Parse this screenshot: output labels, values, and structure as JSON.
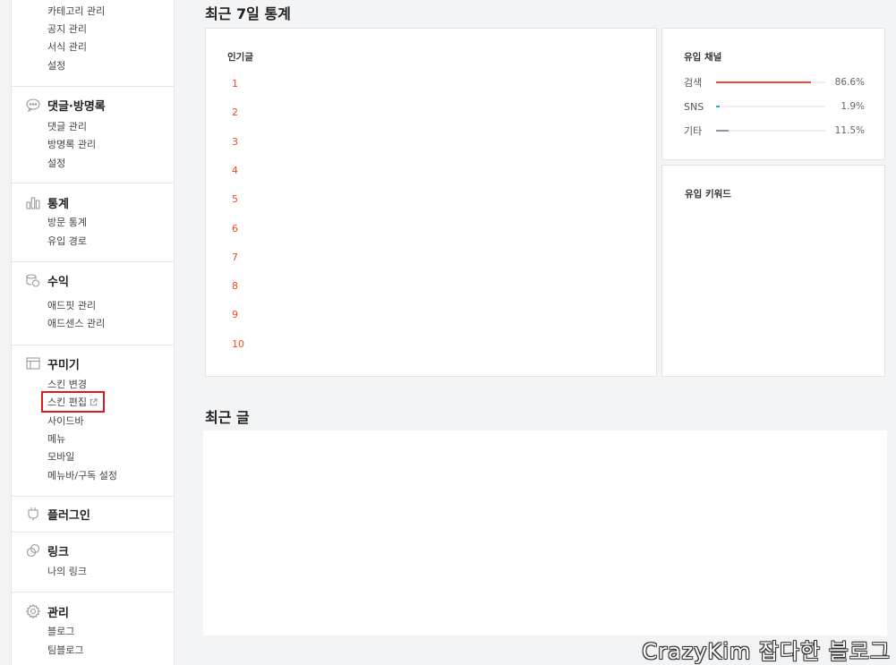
{
  "sidebar": {
    "top_items": [
      "카테고리 관리",
      "공지 관리",
      "서식 관리",
      "설정"
    ],
    "sections": [
      {
        "title": "댓글·방명록",
        "icon": "speech-bubble-icon",
        "items": [
          "댓글 관리",
          "방명록 관리",
          "설정"
        ]
      },
      {
        "title": "통계",
        "icon": "bar-chart-icon",
        "items": [
          "방문 통계",
          "유입 경로"
        ]
      },
      {
        "title": "수익",
        "icon": "coins-icon",
        "items": [
          "애드핏 관리",
          "애드센스 관리"
        ]
      },
      {
        "title": "꾸미기",
        "icon": "layout-icon",
        "items": [
          "스킨 변경",
          "스킨 편집",
          "사이드바",
          "메뉴",
          "모바일",
          "메뉴바/구독 설정"
        ]
      },
      {
        "title": "플러그인",
        "icon": "plug-icon",
        "items": []
      },
      {
        "title": "링크",
        "icon": "link-icon",
        "items": [
          "나의 링크"
        ]
      },
      {
        "title": "관리",
        "icon": "gear-icon",
        "items": [
          "블로그",
          "팀블로그"
        ]
      }
    ]
  },
  "main": {
    "stats_title": "최근 7일 통계",
    "popular": {
      "title": "인기글",
      "ranks": [
        "1",
        "2",
        "3",
        "4",
        "5",
        "6",
        "7",
        "8",
        "9",
        "10"
      ]
    },
    "channels": {
      "title": "유입 채널",
      "rows": [
        {
          "label": "검색",
          "value": "86.6%",
          "fraction": 0.866,
          "color": "#ef4a36"
        },
        {
          "label": "SNS",
          "value": "1.9%",
          "fraction": 0.019,
          "color": "#19b7b7"
        },
        {
          "label": "기타",
          "value": "11.5%",
          "fraction": 0.115,
          "color": "#8e96a6"
        }
      ]
    },
    "keywords": {
      "title": "유입 키워드"
    },
    "recent_title": "최근 글"
  },
  "watermark": "CrazyKim 잡다한 블로그"
}
